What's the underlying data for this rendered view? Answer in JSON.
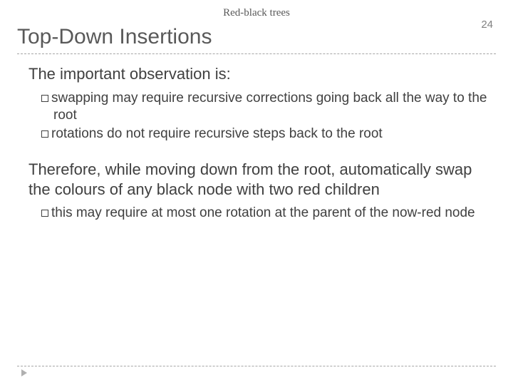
{
  "topic": "Red-black trees",
  "page_number": "24",
  "title": "Top-Down Insertions",
  "para1": "The important observation is:",
  "bullets1": [
    "swapping may require recursive corrections going back all the way to the root",
    "rotations do not require recursive steps back to the root"
  ],
  "para2": "Therefore, while moving down from the root, automatically swap the colours of any black node with two red children",
  "bullets2": [
    "this may require at most one rotation at the parent of the now-red node"
  ]
}
